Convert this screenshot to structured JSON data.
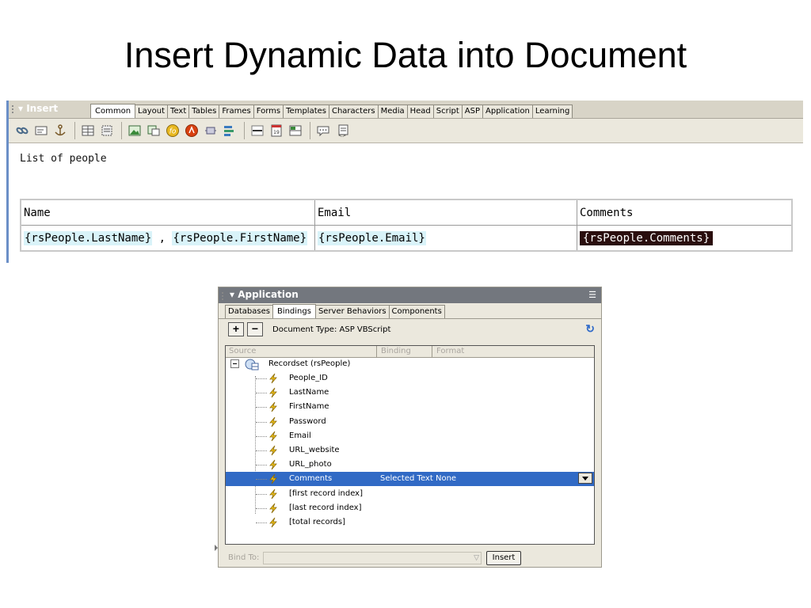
{
  "title": "Insert Dynamic Data into Document",
  "insert_panel": {
    "title": "▾ Insert",
    "tabs": [
      "Common",
      "Layout",
      "Text",
      "Tables",
      "Frames",
      "Forms",
      "Templates",
      "Characters",
      "Media",
      "Head",
      "Script",
      "ASP",
      "Application",
      "Learning"
    ],
    "active_tab": "Common",
    "icons": [
      "hyperlink-icon",
      "email-link-icon",
      "named-anchor-icon",
      "table-icon",
      "layer-icon",
      "image-icon",
      "image-placeholder-icon",
      "flash-icon",
      "shockwave-icon",
      "plugin-icon",
      "navigation-bar-icon",
      "horizontal-rule-icon",
      "date-icon",
      "tabular-data-icon",
      "comment-icon",
      "tag-chooser-icon"
    ]
  },
  "document": {
    "list_label": "List of people",
    "headers": [
      "Name",
      "Email",
      "Comments"
    ],
    "row": {
      "last_name": "{rsPeople.LastName}",
      "separator": " , ",
      "first_name": "{rsPeople.FirstName}",
      "email": "{rsPeople.Email}",
      "comments": "{rsPeople.Comments}"
    }
  },
  "application_panel": {
    "title": "▾ Application",
    "tabs": [
      "Databases",
      "Bindings",
      "Server Behaviors",
      "Components"
    ],
    "active_tab": "Bindings",
    "add_label": "+",
    "remove_label": "−",
    "document_type": "Document Type: ASP VBScript",
    "columns": [
      "Source",
      "Binding",
      "Format"
    ],
    "recordset_label": "Recordset (rsPeople)",
    "fields": [
      "People_ID",
      "LastName",
      "FirstName",
      "Password",
      "Email",
      "URL_website",
      "URL_photo",
      "Comments",
      "[first record index]",
      "[last record index]",
      "[total records]"
    ],
    "selected_field": "Comments",
    "selected_binding": "Selected Text",
    "selected_format": "None",
    "bind_to_label": "Bind To:",
    "insert_label": "Insert"
  },
  "colors": {
    "dynamic_highlight": "#d9f3f9",
    "selection": "#316ac5",
    "panel_header": "#73777e"
  }
}
